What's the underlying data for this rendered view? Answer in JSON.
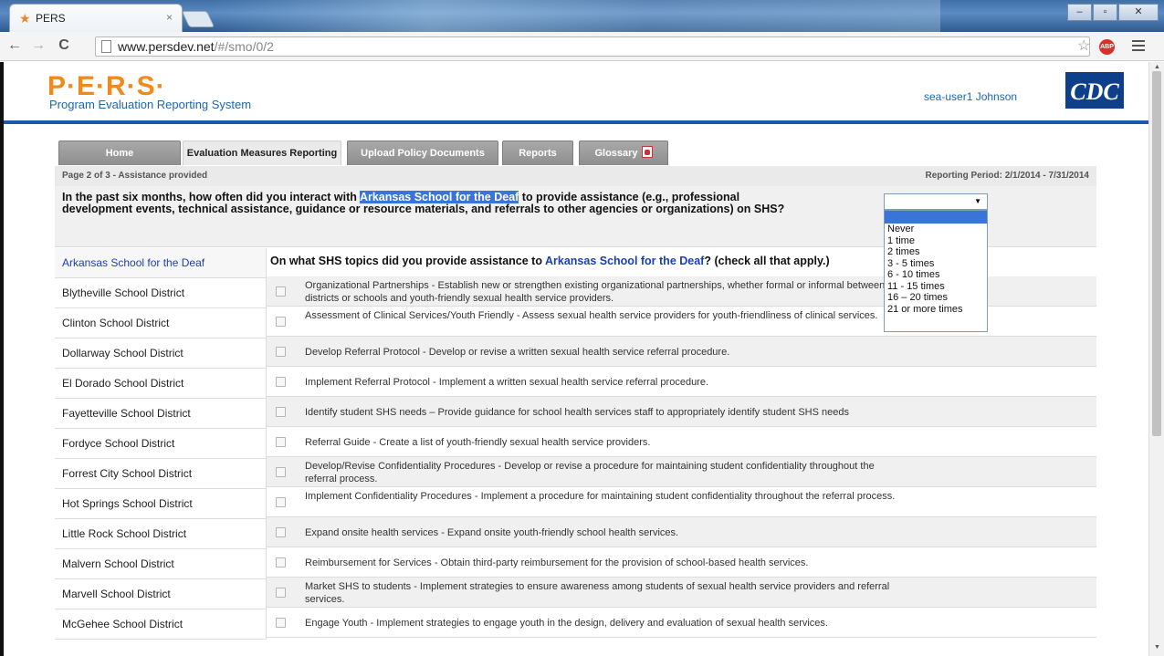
{
  "browser": {
    "tab_title": "PERS",
    "tab_close": "×",
    "url_host": "www.persdev.net",
    "url_path": "/#/smo/0/2",
    "abp_label": "ABP",
    "win_minimize": "–",
    "win_maximize": "▫",
    "win_close": "✕"
  },
  "header": {
    "logo": "P·E·R·S·",
    "subtitle": "Program Evaluation Reporting System",
    "user": "sea-user1 Johnson",
    "cdc_logo": "CDC"
  },
  "nav_tabs": [
    {
      "label": "Home"
    },
    {
      "label": "Evaluation Measures Reporting"
    },
    {
      "label": "Upload Policy Documents"
    },
    {
      "label": "Reports"
    },
    {
      "label": "Glossary"
    }
  ],
  "infobar": {
    "page": "Page 2 of 3 - Assistance provided",
    "reporting_period": "Reporting Period: 2/1/2014 - 7/31/2014"
  },
  "question": {
    "prefix": "In the past six months, how often did you interact with ",
    "org": "Arkansas School for the Deaf",
    "suffix": " to provide assistance (e.g., professional development events, technical assistance, guidance or resource materials, and referrals to other agencies or organizations) on SHS?"
  },
  "frequency_select": {
    "value": "",
    "options": [
      "",
      "Never",
      "1 time",
      "2 times",
      "3 - 5 times",
      "6 - 10 times",
      "11 - 15 times",
      "16 – 20 times",
      "21 or more times"
    ]
  },
  "districts": [
    "Arkansas School for the Deaf",
    "Blytheville School District",
    "Clinton School District",
    "Dollarway School District",
    "El Dorado School District",
    "Fayetteville School District",
    "Fordyce School District",
    "Forrest City School District",
    "Hot Springs School District",
    "Little Rock School District",
    "Malvern School District",
    "Marvell School District",
    "McGehee School District"
  ],
  "topics_header": {
    "prefix": "On what SHS topics did you provide assistance to ",
    "org": "Arkansas School for the Deaf",
    "suffix": "? (check all that apply.)"
  },
  "topics": [
    "Organizational Partnerships - Establish new or strengthen existing organizational partnerships, whether formal or informal between districts or schools and youth-friendly sexual health service providers.",
    "Assessment of Clinical Services/Youth Friendly - Assess sexual health service providers for youth-friendliness of clinical services.",
    "Develop Referral Protocol - Develop or revise a written sexual health service referral procedure.",
    "Implement Referral Protocol - Implement a written sexual health service referral procedure.",
    "Identify student SHS needs – Provide guidance for school health services staff to appropriately identify student SHS needs",
    "Referral Guide - Create a list of youth-friendly sexual health service providers.",
    "Develop/Revise Confidentiality Procedures - Develop or revise a procedure for maintaining student confidentiality throughout the referral process.",
    "Implement Confidentiality Procedures - Implement a procedure for maintaining student confidentiality throughout the referral process.",
    "Expand onsite health services - Expand onsite youth-friendly school health services.",
    "Reimbursement for Services - Obtain third-party reimbursement for the provision of school-based health services.",
    "Market SHS to students - Implement strategies to ensure awareness among students of sexual health service providers and referral services.",
    "Engage Youth - Implement strategies to engage youth in the design, delivery and evaluation of sexual health services."
  ]
}
